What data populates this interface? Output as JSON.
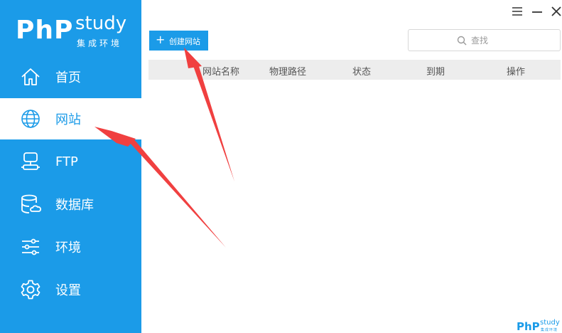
{
  "sidebar": {
    "logo": {
      "php": "PhP",
      "study": "study",
      "subtitle": "集成环境"
    },
    "items": [
      {
        "label": "首页",
        "icon": "home-icon"
      },
      {
        "label": "网站",
        "icon": "globe-icon"
      },
      {
        "label": "FTP",
        "icon": "ftp-server-icon"
      },
      {
        "label": "数据库",
        "icon": "database-icon"
      },
      {
        "label": "环境",
        "icon": "sliders-icon"
      },
      {
        "label": "设置",
        "icon": "gear-icon"
      }
    ],
    "active_index": 1
  },
  "window_controls": {
    "menu": "menu-icon",
    "minimize": "minimize-icon",
    "close": "close-icon"
  },
  "toolbar": {
    "create_label": "创建网站",
    "search_placeholder": "查找"
  },
  "table": {
    "columns": [
      "网站名称",
      "物理路径",
      "状态",
      "到期",
      "操作"
    ],
    "rows": []
  },
  "footer_logo": {
    "php": "PhP",
    "study": "study",
    "subtitle": "集成环境"
  },
  "colors": {
    "primary": "#1b9be8",
    "annotation_arrow": "#f04040",
    "table_header_bg": "#ededed"
  }
}
